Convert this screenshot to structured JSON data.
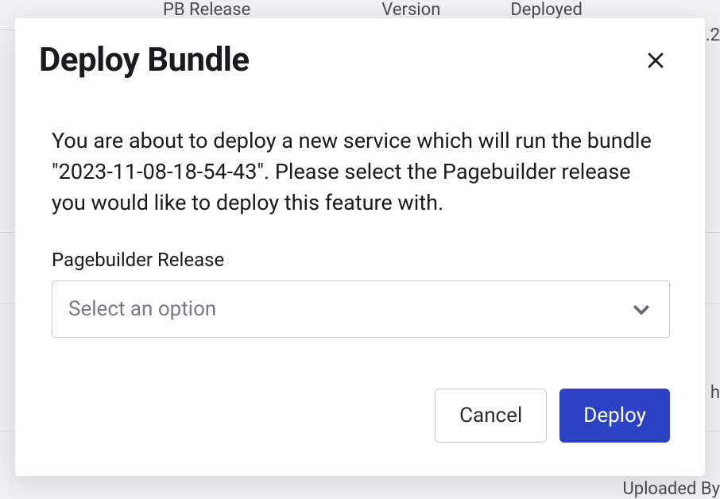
{
  "background": {
    "columns": {
      "pb_release": "PB Release",
      "version": "Version",
      "deployed": "Deployed"
    },
    "partial_right": ".2",
    "partial_h": "h",
    "uploaded_by": "Uploaded By"
  },
  "modal": {
    "title": "Deploy Bundle",
    "description": "You are about to deploy a new service which will run the bundle \"2023-11-08-18-54-43\". Please select the Pagebuilder release you would like to deploy this feature with.",
    "field": {
      "label": "Pagebuilder Release",
      "placeholder": "Select an option"
    },
    "buttons": {
      "cancel": "Cancel",
      "deploy": "Deploy"
    }
  }
}
